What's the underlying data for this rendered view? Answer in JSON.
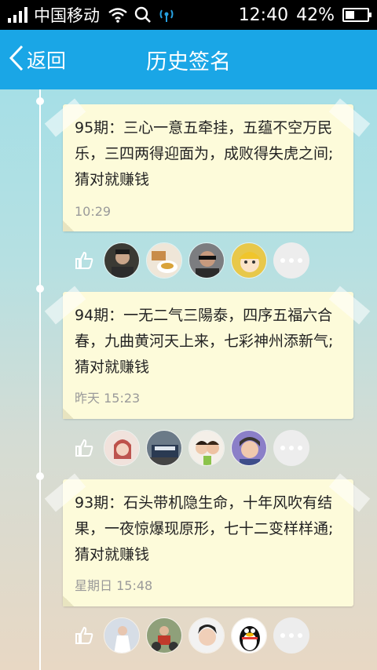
{
  "status_bar": {
    "carrier": "中国移动",
    "time": "12:40",
    "battery": "42%",
    "battery_level": 0.42
  },
  "header": {
    "back_label": "返回",
    "title": "历史签名"
  },
  "entries": [
    {
      "text": "95期：三心一意五牵挂，五蕴不空万民乐，三四两得迎面为，成败得失虎之间; 猜对就赚钱",
      "time": "10:29",
      "avatars": [
        "avatar-user",
        "avatar-food",
        "avatar-sunglasses",
        "avatar-cartoon"
      ]
    },
    {
      "text": "94期：一无二气三陽泰，四序五福六合春，九曲黄河天上来，七彩神州添新气; 猜对就赚钱",
      "time": "昨天 15:23",
      "avatars": [
        "avatar-girl",
        "avatar-building",
        "avatar-couple",
        "avatar-boy"
      ]
    },
    {
      "text": "93期：石头带机隐生命，十年风吹有结果，一夜惊爆现原形，七十二变样样通;猜对就赚钱",
      "time": "星期日 15:48",
      "avatars": [
        "avatar-bride",
        "avatar-motorbike",
        "avatar-young-man",
        "avatar-qq-penguin"
      ]
    }
  ],
  "colors": {
    "header_bg": "#1aa6e6",
    "card_bg": "#fdfbda",
    "time_text": "#9a9a9a"
  }
}
